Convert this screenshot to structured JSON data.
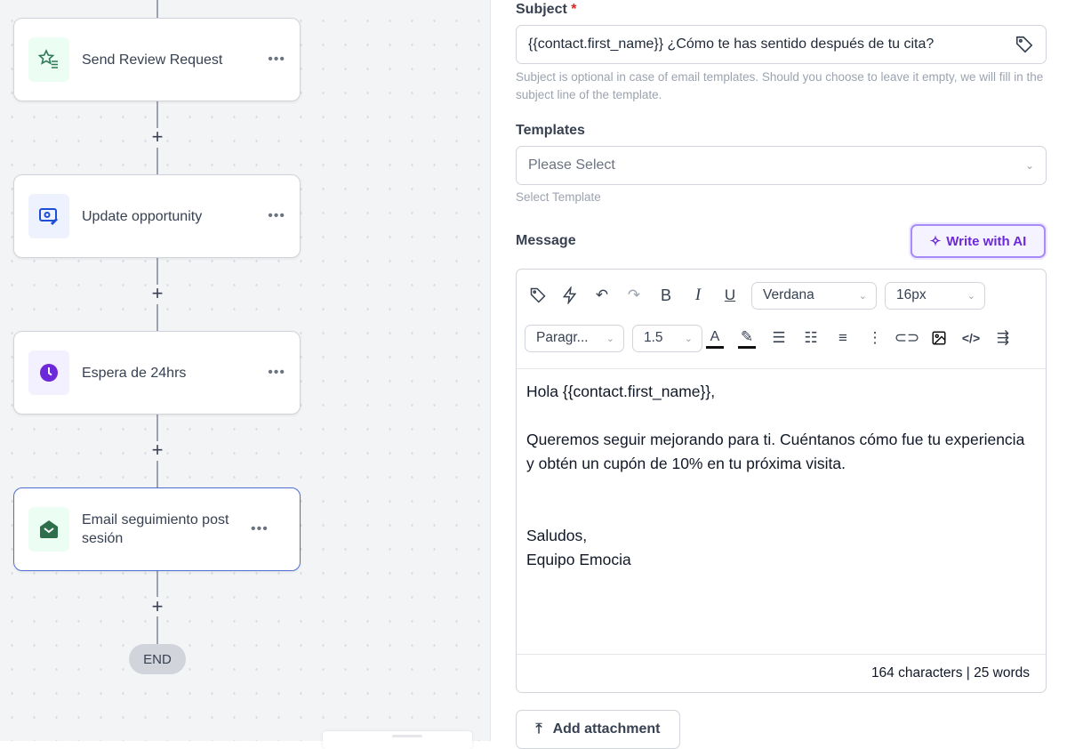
{
  "workflow": {
    "nodes": [
      {
        "label": "Send Review Request",
        "icon": "star-list-icon",
        "color": "#2f7a55",
        "bg": "#ecfdf3"
      },
      {
        "label": "Update opportunity",
        "icon": "money-edit-icon",
        "color": "#1d4ed8",
        "bg": "#eef2ff"
      },
      {
        "label": "Espera de 24hrs",
        "icon": "clock-icon",
        "color": "#6d28d9",
        "bg": "#f3f0ff"
      },
      {
        "label": "Email seguimiento post sesión",
        "icon": "envelope-open-icon",
        "color": "#2f6e4d",
        "bg": "#ecfdf3"
      }
    ],
    "more_label": "•••",
    "add_label": "+",
    "end_label": "END"
  },
  "form": {
    "subject_label": "Subject",
    "required_mark": "*",
    "subject_value": "{{contact.first_name}} ¿Cómo te has sentido después de tu cita?",
    "subject_help": "Subject is optional in case of email templates. Should you choose to leave it empty, we will fill in the subject line of the template.",
    "templates_label": "Templates",
    "templates_placeholder": "Please Select",
    "templates_help": "Select Template",
    "message_label": "Message",
    "ai_button": "Write with AI",
    "toolbar": {
      "font": "Verdana",
      "size": "16px",
      "block": "Paragr...",
      "line_height": "1.5"
    },
    "message_body": "Hola {{contact.first_name}},\n\nQueremos seguir mejorando para ti. Cuéntanos cómo fue tu experiencia y obtén un cupón de 10% en tu próxima visita.\n\n\nSaludos,\nEquipo Emocia",
    "counts": "164 characters | 25 words",
    "attach_button": "Add attachment"
  }
}
